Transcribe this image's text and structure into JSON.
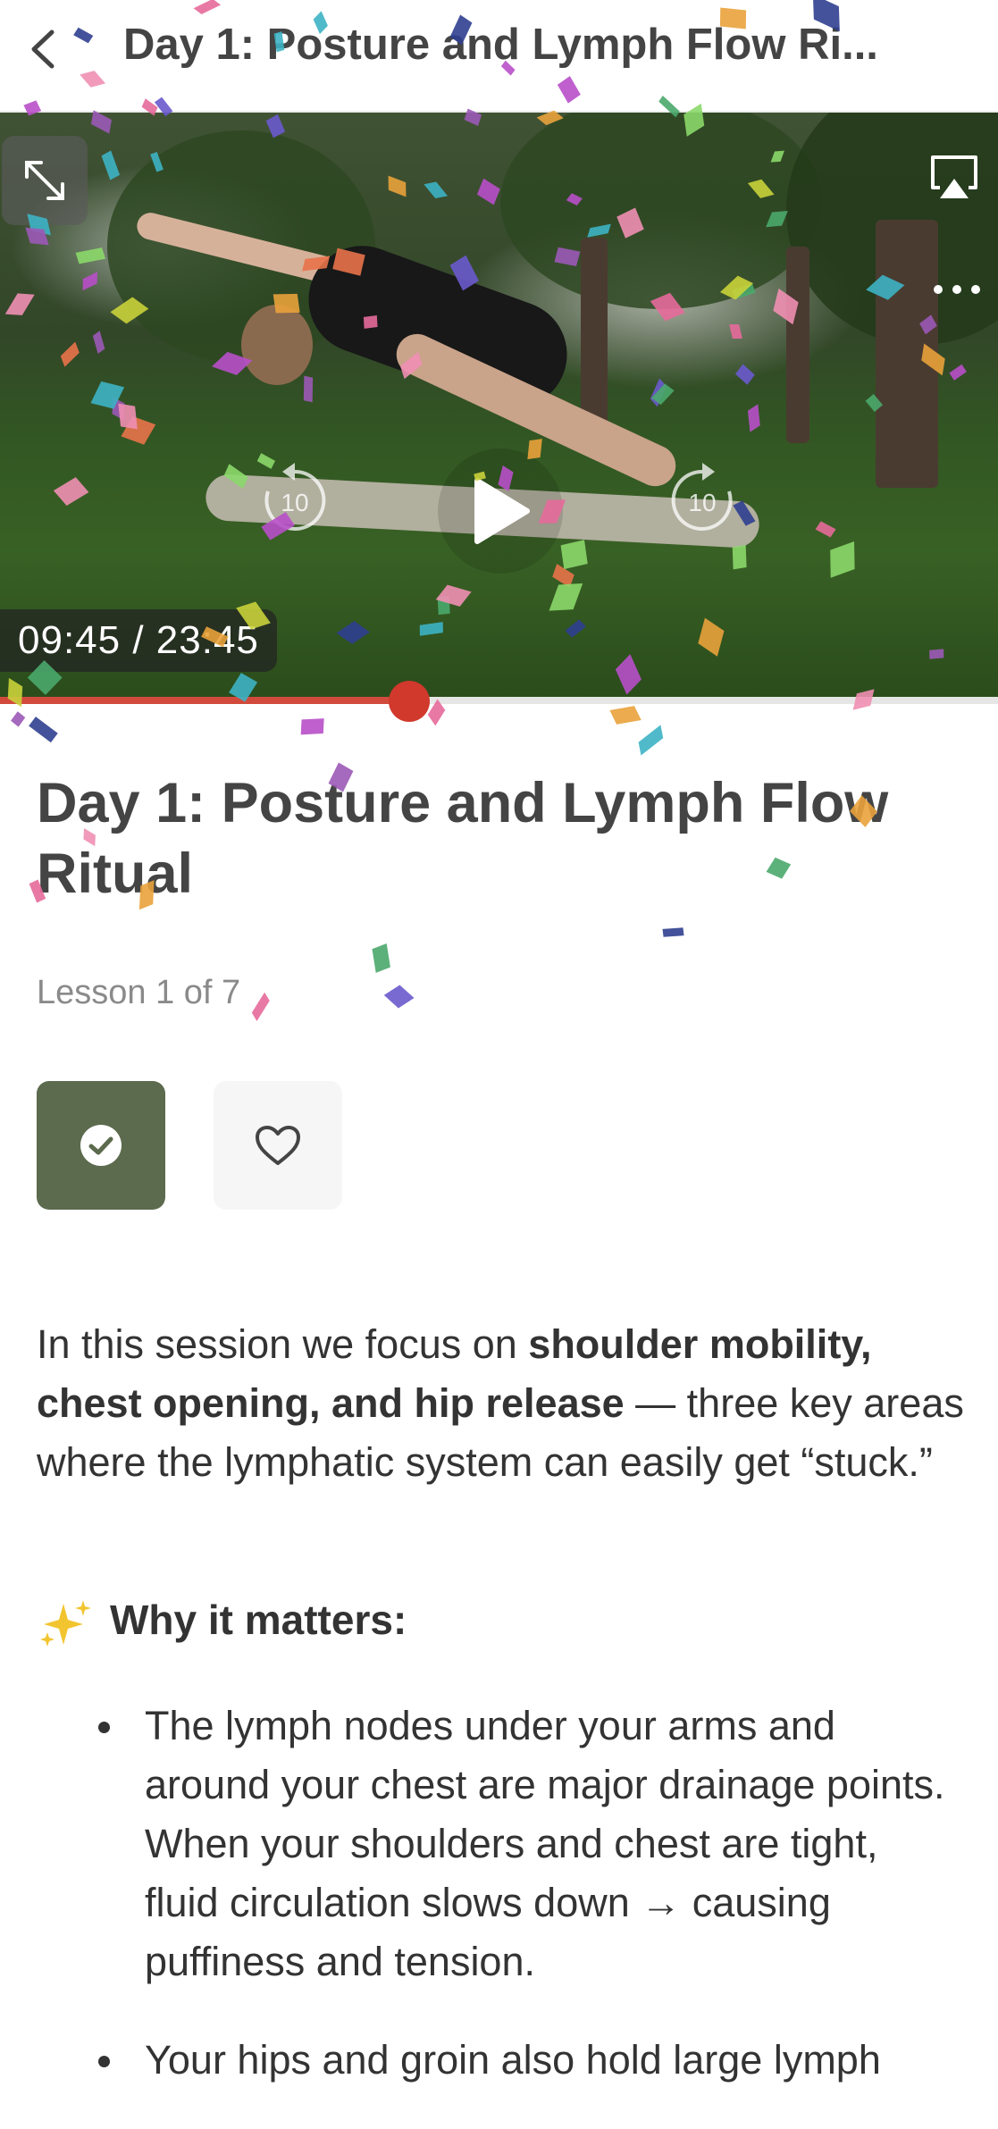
{
  "header": {
    "title": "Day 1: Posture and Lymph Flow Ri...",
    "back_icon": "chevron-left-icon"
  },
  "video": {
    "time_display": "09:45 / 23:45",
    "progress_fraction": 0.41,
    "rewind_seconds": "10",
    "forward_seconds": "10",
    "icons": [
      "expand-icon",
      "airplay-icon",
      "more-icon",
      "rewind-10-icon",
      "play-icon",
      "forward-10-icon"
    ]
  },
  "lesson": {
    "title": "Day 1: Posture and Lymph Flow Ritual",
    "count": "Lesson 1 of 7"
  },
  "actions": {
    "complete_icon": "check-circle-icon",
    "favorite_icon": "heart-icon",
    "complete_color": "#5c6a4e"
  },
  "body": {
    "intro_start": "In this session we focus on ",
    "intro_bold": "shoulder mobility, chest opening, and hip release",
    "intro_end": " — three key areas where the lymphatic system can easily get “stuck.”",
    "why_heading": "Why it matters:",
    "why_icon": "sparkles-icon",
    "bullets": [
      "The lymph nodes under your arms and around your chest are major drainage points. When your shoulders and chest are tight, fluid circulation slows down → causing puffiness and tension.",
      "Your hips and groin also hold large lymph"
    ]
  },
  "colors": {
    "accent": "#d0392c",
    "header_text": "#444444"
  }
}
